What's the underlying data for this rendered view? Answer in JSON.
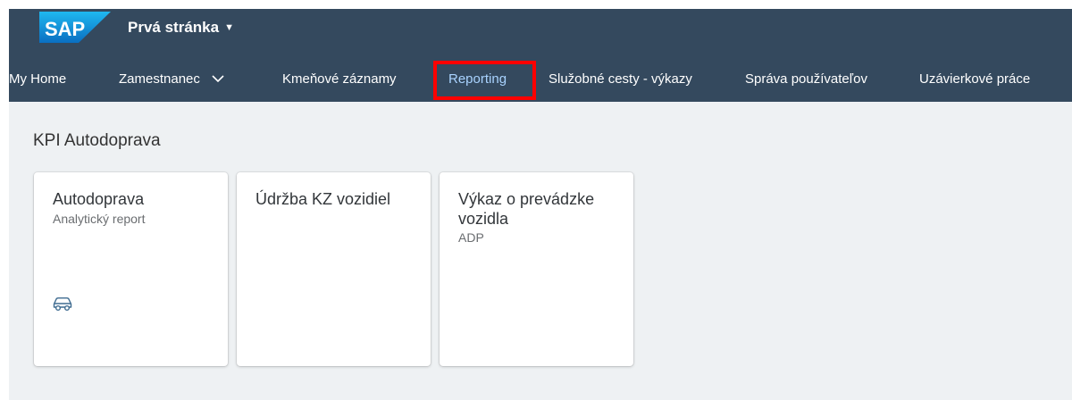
{
  "header": {
    "logo_text": "SAP",
    "page_title": "Prvá stránka"
  },
  "nav": {
    "items": [
      {
        "label": "My Home"
      },
      {
        "label": "Zamestnanec"
      },
      {
        "label": "Kmeňové záznamy"
      },
      {
        "label": "Reporting"
      },
      {
        "label": "Služobné cesty - výkazy"
      },
      {
        "label": "Správa používateľov"
      },
      {
        "label": "Uzávierkové práce"
      }
    ],
    "active": "Reporting"
  },
  "section": {
    "title": "KPI Autodoprava",
    "tiles": [
      {
        "title": "Autodoprava",
        "subtitle": "Analytický report",
        "icon": "car-icon"
      },
      {
        "title": "Údržba KZ vozidiel"
      },
      {
        "title": "Výkaz o prevádzke vozidla",
        "subtitle": "ADP"
      }
    ]
  },
  "colors": {
    "shell_bar": "#34495e",
    "active_nav": "#a9d3ff",
    "highlight": "#ff0000",
    "background": "#eef1f3"
  }
}
